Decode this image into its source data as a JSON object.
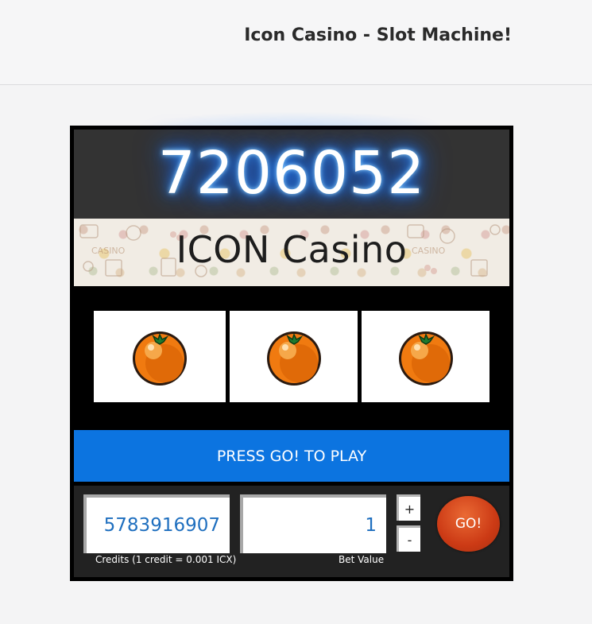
{
  "header": {
    "title": "Icon Casino - Slot Machine!"
  },
  "machine": {
    "jackpot": "7206052",
    "banner_title": "ICON Casino",
    "reels": [
      {
        "symbol": "orange-icon"
      },
      {
        "symbol": "orange-icon"
      },
      {
        "symbol": "orange-icon"
      }
    ],
    "message": "PRESS GO! TO PLAY",
    "credits": {
      "value": "5783916907",
      "label": "Credits (1 credit = 0.001 ICX)"
    },
    "bet": {
      "value": "1",
      "label": "Bet Value",
      "increase_label": "+",
      "decrease_label": "-"
    },
    "go_label": "GO!"
  },
  "colors": {
    "message_bar": "#0c74e0",
    "go_button": "#cc3a15",
    "jackpot_glow": "#2a8cff",
    "value_text": "#1f6fbf"
  }
}
